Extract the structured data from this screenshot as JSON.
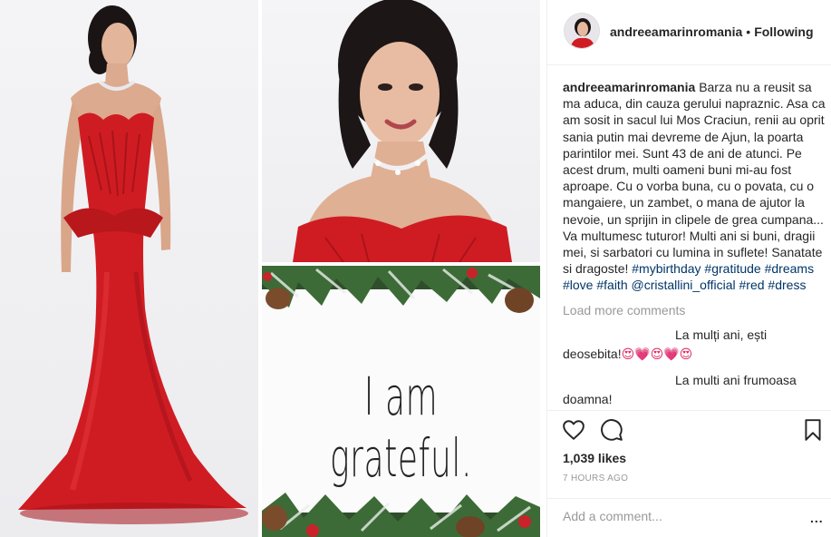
{
  "post": {
    "username": "andreeamarinromania",
    "separator": "•",
    "follow_status": "Following"
  },
  "caption": {
    "username": "andreeamarinromania",
    "text": "Barza nu a reusit sa ma aduca, din cauza gerului napraznic. Asa ca am sosit in sacul lui Mos Craciun, renii au oprit sania putin mai devreme de Ajun, la poarta parintilor mei. Sunt 43 de ani de atunci. Pe acest drum, multi oameni buni mi-au fost aproape. Cu o vorba buna, cu o povata, cu o mangaiere, un zambet, o mana de ajutor la nevoie, un sprijin in clipele de grea cumpana... Va multumesc tuturor! Multi ani si buni, dragii mei, si sarbatori cu lumina in suflete! Sanatate si dragoste!",
    "hashtags": {
      "h1": "#mybirthday",
      "h2": "#gratitude",
      "h3": "#dreams",
      "h4": "#love",
      "h5": "#faith",
      "h6": "@cristallini_official",
      "h7": "#red",
      "h8": "#dress"
    }
  },
  "load_more": "Load more comments",
  "comments": [
    {
      "username": "",
      "text": "La mulți ani, ești deosebita!",
      "emoji": "😍💗😍💗😍"
    },
    {
      "username": "",
      "text": "La multi ani frumoasa doamna!"
    }
  ],
  "actions": {
    "like_icon": "heart-icon",
    "comment_icon": "speech-bubble-icon",
    "save_icon": "bookmark-icon"
  },
  "likes": "1,039 likes",
  "timestamp": "7 HOURS AGO",
  "add_comment": {
    "placeholder": "Add a comment..."
  },
  "more_options": "...",
  "images": {
    "grateful_text": "I am grateful."
  },
  "colors": {
    "dress_red": "#d01d22",
    "link_blue": "#003569",
    "muted_gray": "#999999",
    "border": "#efefef"
  }
}
